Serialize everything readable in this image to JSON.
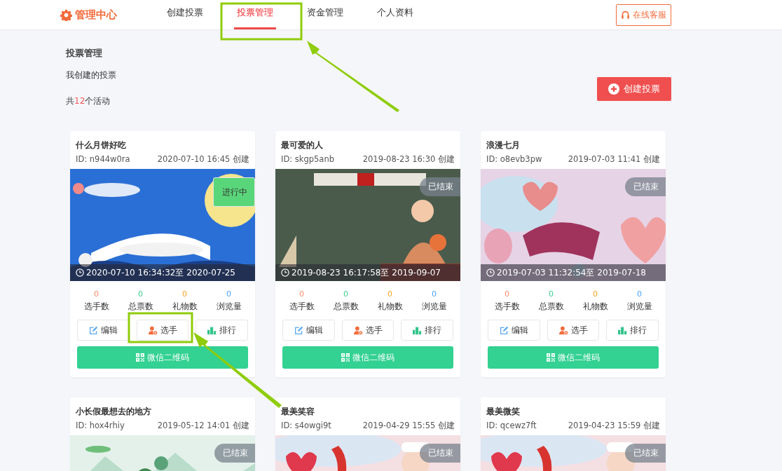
{
  "header": {
    "logo": "管理中心",
    "nav": [
      {
        "label": "创建投票",
        "selected": false
      },
      {
        "label": "投票管理",
        "selected": true
      },
      {
        "label": "资金管理",
        "selected": false
      },
      {
        "label": "个人资料",
        "selected": false
      }
    ],
    "service_button": "在线客服"
  },
  "page": {
    "title": "投票管理",
    "subtitle": "我创建的投票",
    "count_prefix": "共",
    "count": "12",
    "count_suffix": "个活动",
    "create_button": "创建投票"
  },
  "cards": [
    {
      "title": "什么月饼好吃",
      "id": "ID: n944w0ra",
      "created": "2020-07-10 16:45 创建",
      "status": {
        "label": "进行中",
        "kind": "active"
      },
      "period": "2020-07-10 16:34:32至 2020-07-25",
      "stats": [
        {
          "value": "0",
          "label": "选手数",
          "color": "#f98b6b"
        },
        {
          "value": "0",
          "label": "总票数",
          "color": "#3ccf8e"
        },
        {
          "value": "0",
          "label": "礼物数",
          "color": "#f5a623"
        },
        {
          "value": "0",
          "label": "浏览量",
          "color": "#4aa3f5"
        }
      ],
      "actions": [
        "编辑",
        "选手",
        "排行"
      ],
      "qr_button": "微信二维码"
    },
    {
      "title": "最可爱的人",
      "id": "ID: skgp5anb",
      "created": "2019-08-23 16:30 创建",
      "status": {
        "label": "已结束",
        "kind": "ended"
      },
      "period": "2019-08-23 16:17:58至 2019-09-07",
      "stats": [
        {
          "value": "0",
          "label": "选手数",
          "color": "#f98b6b"
        },
        {
          "value": "0",
          "label": "总票数",
          "color": "#3ccf8e"
        },
        {
          "value": "0",
          "label": "礼物数",
          "color": "#f5a623"
        },
        {
          "value": "0",
          "label": "浏览量",
          "color": "#4aa3f5"
        }
      ],
      "actions": [
        "编辑",
        "选手",
        "排行"
      ],
      "qr_button": "微信二维码"
    },
    {
      "title": "浪漫七月",
      "id": "ID: o8evb3pw",
      "created": "2019-07-03 11:41 创建",
      "status": {
        "label": "已结束",
        "kind": "ended"
      },
      "period": "2019-07-03 11:32:54至 2019-07-18",
      "stats": [
        {
          "value": "0",
          "label": "选手数",
          "color": "#f98b6b"
        },
        {
          "value": "0",
          "label": "总票数",
          "color": "#3ccf8e"
        },
        {
          "value": "0",
          "label": "礼物数",
          "color": "#f5a623"
        },
        {
          "value": "0",
          "label": "浏览量",
          "color": "#4aa3f5"
        }
      ],
      "actions": [
        "编辑",
        "选手",
        "排行"
      ],
      "qr_button": "微信二维码"
    },
    {
      "title": "小长假最想去的地方",
      "id": "ID: hox4rhiy",
      "created": "2019-05-12 14:01 创建",
      "status": {
        "label": "已结束",
        "kind": "ended"
      }
    },
    {
      "title": "最美笑容",
      "id": "ID: s4owgi9t",
      "created": "2019-04-29 15:55 创建",
      "status": {
        "label": "已结束",
        "kind": "ended"
      }
    },
    {
      "title": "最美微笑",
      "id": "ID: qcewz7ft",
      "created": "2019-04-23 15:59 创建",
      "status": {
        "label": "已结束",
        "kind": "ended"
      }
    }
  ]
}
